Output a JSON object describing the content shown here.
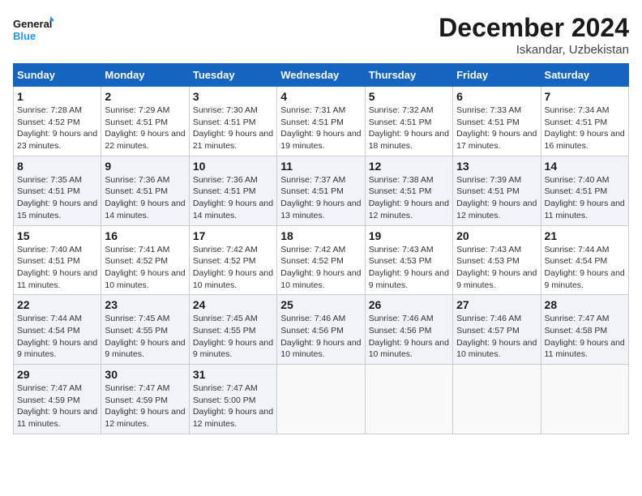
{
  "header": {
    "logo_line1": "General",
    "logo_line2": "Blue",
    "month_title": "December 2024",
    "location": "Iskandar, Uzbekistan"
  },
  "weekdays": [
    "Sunday",
    "Monday",
    "Tuesday",
    "Wednesday",
    "Thursday",
    "Friday",
    "Saturday"
  ],
  "weeks": [
    [
      {
        "day": "1",
        "sunrise": "Sunrise: 7:28 AM",
        "sunset": "Sunset: 4:52 PM",
        "daylight": "Daylight: 9 hours and 23 minutes."
      },
      {
        "day": "2",
        "sunrise": "Sunrise: 7:29 AM",
        "sunset": "Sunset: 4:51 PM",
        "daylight": "Daylight: 9 hours and 22 minutes."
      },
      {
        "day": "3",
        "sunrise": "Sunrise: 7:30 AM",
        "sunset": "Sunset: 4:51 PM",
        "daylight": "Daylight: 9 hours and 21 minutes."
      },
      {
        "day": "4",
        "sunrise": "Sunrise: 7:31 AM",
        "sunset": "Sunset: 4:51 PM",
        "daylight": "Daylight: 9 hours and 19 minutes."
      },
      {
        "day": "5",
        "sunrise": "Sunrise: 7:32 AM",
        "sunset": "Sunset: 4:51 PM",
        "daylight": "Daylight: 9 hours and 18 minutes."
      },
      {
        "day": "6",
        "sunrise": "Sunrise: 7:33 AM",
        "sunset": "Sunset: 4:51 PM",
        "daylight": "Daylight: 9 hours and 17 minutes."
      },
      {
        "day": "7",
        "sunrise": "Sunrise: 7:34 AM",
        "sunset": "Sunset: 4:51 PM",
        "daylight": "Daylight: 9 hours and 16 minutes."
      }
    ],
    [
      {
        "day": "8",
        "sunrise": "Sunrise: 7:35 AM",
        "sunset": "Sunset: 4:51 PM",
        "daylight": "Daylight: 9 hours and 15 minutes."
      },
      {
        "day": "9",
        "sunrise": "Sunrise: 7:36 AM",
        "sunset": "Sunset: 4:51 PM",
        "daylight": "Daylight: 9 hours and 14 minutes."
      },
      {
        "day": "10",
        "sunrise": "Sunrise: 7:36 AM",
        "sunset": "Sunset: 4:51 PM",
        "daylight": "Daylight: 9 hours and 14 minutes."
      },
      {
        "day": "11",
        "sunrise": "Sunrise: 7:37 AM",
        "sunset": "Sunset: 4:51 PM",
        "daylight": "Daylight: 9 hours and 13 minutes."
      },
      {
        "day": "12",
        "sunrise": "Sunrise: 7:38 AM",
        "sunset": "Sunset: 4:51 PM",
        "daylight": "Daylight: 9 hours and 12 minutes."
      },
      {
        "day": "13",
        "sunrise": "Sunrise: 7:39 AM",
        "sunset": "Sunset: 4:51 PM",
        "daylight": "Daylight: 9 hours and 12 minutes."
      },
      {
        "day": "14",
        "sunrise": "Sunrise: 7:40 AM",
        "sunset": "Sunset: 4:51 PM",
        "daylight": "Daylight: 9 hours and 11 minutes."
      }
    ],
    [
      {
        "day": "15",
        "sunrise": "Sunrise: 7:40 AM",
        "sunset": "Sunset: 4:51 PM",
        "daylight": "Daylight: 9 hours and 11 minutes."
      },
      {
        "day": "16",
        "sunrise": "Sunrise: 7:41 AM",
        "sunset": "Sunset: 4:52 PM",
        "daylight": "Daylight: 9 hours and 10 minutes."
      },
      {
        "day": "17",
        "sunrise": "Sunrise: 7:42 AM",
        "sunset": "Sunset: 4:52 PM",
        "daylight": "Daylight: 9 hours and 10 minutes."
      },
      {
        "day": "18",
        "sunrise": "Sunrise: 7:42 AM",
        "sunset": "Sunset: 4:52 PM",
        "daylight": "Daylight: 9 hours and 10 minutes."
      },
      {
        "day": "19",
        "sunrise": "Sunrise: 7:43 AM",
        "sunset": "Sunset: 4:53 PM",
        "daylight": "Daylight: 9 hours and 9 minutes."
      },
      {
        "day": "20",
        "sunrise": "Sunrise: 7:43 AM",
        "sunset": "Sunset: 4:53 PM",
        "daylight": "Daylight: 9 hours and 9 minutes."
      },
      {
        "day": "21",
        "sunrise": "Sunrise: 7:44 AM",
        "sunset": "Sunset: 4:54 PM",
        "daylight": "Daylight: 9 hours and 9 minutes."
      }
    ],
    [
      {
        "day": "22",
        "sunrise": "Sunrise: 7:44 AM",
        "sunset": "Sunset: 4:54 PM",
        "daylight": "Daylight: 9 hours and 9 minutes."
      },
      {
        "day": "23",
        "sunrise": "Sunrise: 7:45 AM",
        "sunset": "Sunset: 4:55 PM",
        "daylight": "Daylight: 9 hours and 9 minutes."
      },
      {
        "day": "24",
        "sunrise": "Sunrise: 7:45 AM",
        "sunset": "Sunset: 4:55 PM",
        "daylight": "Daylight: 9 hours and 9 minutes."
      },
      {
        "day": "25",
        "sunrise": "Sunrise: 7:46 AM",
        "sunset": "Sunset: 4:56 PM",
        "daylight": "Daylight: 9 hours and 10 minutes."
      },
      {
        "day": "26",
        "sunrise": "Sunrise: 7:46 AM",
        "sunset": "Sunset: 4:56 PM",
        "daylight": "Daylight: 9 hours and 10 minutes."
      },
      {
        "day": "27",
        "sunrise": "Sunrise: 7:46 AM",
        "sunset": "Sunset: 4:57 PM",
        "daylight": "Daylight: 9 hours and 10 minutes."
      },
      {
        "day": "28",
        "sunrise": "Sunrise: 7:47 AM",
        "sunset": "Sunset: 4:58 PM",
        "daylight": "Daylight: 9 hours and 11 minutes."
      }
    ],
    [
      {
        "day": "29",
        "sunrise": "Sunrise: 7:47 AM",
        "sunset": "Sunset: 4:59 PM",
        "daylight": "Daylight: 9 hours and 11 minutes."
      },
      {
        "day": "30",
        "sunrise": "Sunrise: 7:47 AM",
        "sunset": "Sunset: 4:59 PM",
        "daylight": "Daylight: 9 hours and 12 minutes."
      },
      {
        "day": "31",
        "sunrise": "Sunrise: 7:47 AM",
        "sunset": "Sunset: 5:00 PM",
        "daylight": "Daylight: 9 hours and 12 minutes."
      },
      null,
      null,
      null,
      null
    ]
  ]
}
